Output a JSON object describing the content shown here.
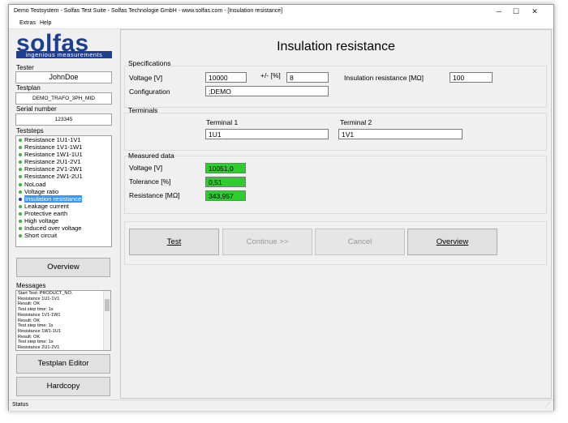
{
  "window": {
    "title": "Demo Testsystem - Solfas Test Suite - Solfas Technologie GmbH - www.solfas.com - [Insulation resistance]",
    "controls": {
      "minimize": "─",
      "maximize": "☐",
      "close": "✕"
    }
  },
  "menu": [
    "Extras",
    "Help"
  ],
  "logo": {
    "word": "solfas",
    "tagline": "ingenious measurements"
  },
  "sidebar": {
    "tester_label": "Tester",
    "tester": "JohnDoe",
    "testplan_label": "Testplan",
    "testplan": "DEMO_TRAFO_3PH_MID",
    "serial_label": "Serial number",
    "serial": "123345",
    "teststeps_label": "Teststeps",
    "steps": [
      {
        "label": "Resistance 1U1-1V1"
      },
      {
        "label": "Resistance 1V1-1W1"
      },
      {
        "label": "Resistance 1W1-1U1"
      },
      {
        "label": "Resistance 2U1-2V1"
      },
      {
        "label": "Resistance 2V1-2W1"
      },
      {
        "label": "Resistance 2W1-2U1"
      },
      {
        "label": "NoLoad"
      },
      {
        "label": "Voltage ratio"
      },
      {
        "label": "Insulation resistance"
      },
      {
        "label": "Leakage current"
      },
      {
        "label": "Protective earth"
      },
      {
        "label": "High voltage"
      },
      {
        "label": "Induced over voltage"
      },
      {
        "label": "Short circuit"
      }
    ],
    "selected_step": 8,
    "overview_button": "Overview",
    "messages_label": "Messages",
    "messages": [
      "Start Test: PRODUCT_NO.",
      "Resistance 1U1-1V1",
      "Result: OK",
      "Test step time: 1s",
      "Resistance 1V1-1W1",
      "Result: OK",
      "Test step time: 1s",
      "Resistance 1W1-1U1",
      "Result: OK",
      "Test step time: 1s",
      "Resistance 2U1-2V1"
    ],
    "testplan_editor_button": "Testplan Editor",
    "hardcopy_button": "Hardcopy"
  },
  "main": {
    "title": "Insulation resistance",
    "specifications": {
      "label": "Specifications",
      "voltage_label": "Voltage [V]",
      "voltage": "10000",
      "tolerance_label": "+/- [%]",
      "tolerance": "8",
      "insulation_label": "Insulation resistance [MΩ]",
      "insulation": "100",
      "configuration_label": "Configuration",
      "configuration": ";DEMO"
    },
    "terminals": {
      "label": "Terminals",
      "terminal1_label": "Terminal 1",
      "terminal1": "1U1",
      "terminal2_label": "Terminal 2",
      "terminal2": "1V1"
    },
    "measured": {
      "label": "Measured data",
      "voltage_label": "Voltage [V]",
      "voltage": "10051,0",
      "tolerance_label": "Tolerance [%]",
      "tolerance": "0,51",
      "resistance_label": "Resistance [MΩ]",
      "resistance": "343,957",
      "result_color": "#2ecc2e"
    },
    "buttons": {
      "test": "Test",
      "continue": "Continue >>",
      "cancel": "Cancel",
      "overview": "Overview"
    }
  },
  "status": "Status"
}
